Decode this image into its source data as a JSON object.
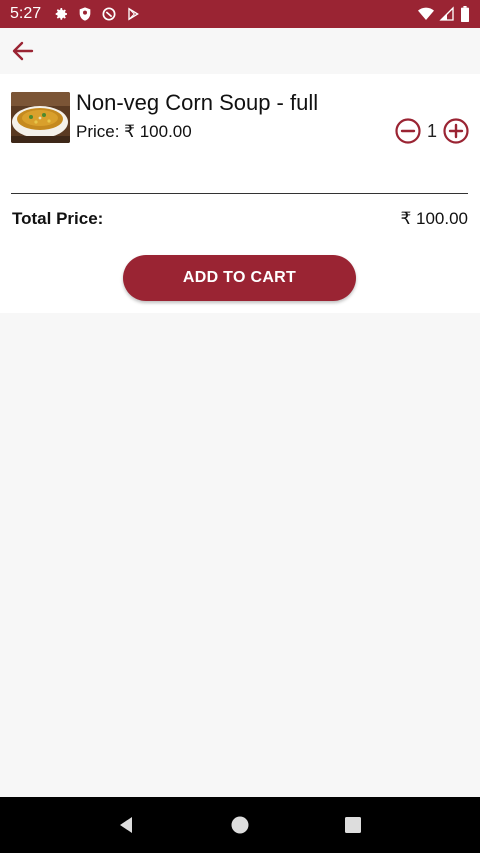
{
  "status_bar": {
    "time": "5:27",
    "icons_left": [
      "gear-icon",
      "shield-icon",
      "do-not-disturb-icon",
      "play-store-icon"
    ],
    "icons_right": [
      "wifi-icon",
      "signal-icon",
      "battery-icon"
    ]
  },
  "toolbar": {
    "back_icon": "arrow-left-icon"
  },
  "item": {
    "name": "Non-veg Corn Soup - full",
    "price_label": "Price: ₹ 100.00",
    "quantity": "1",
    "image": "soup-bowl-image"
  },
  "totals": {
    "label": "Total Price:",
    "value": "₹ 100.00"
  },
  "actions": {
    "add_to_cart": "ADD TO CART"
  },
  "colors": {
    "brand": "#9a2433",
    "background": "#f7f7f7",
    "card": "#ffffff",
    "nav_bar": "#000000"
  }
}
